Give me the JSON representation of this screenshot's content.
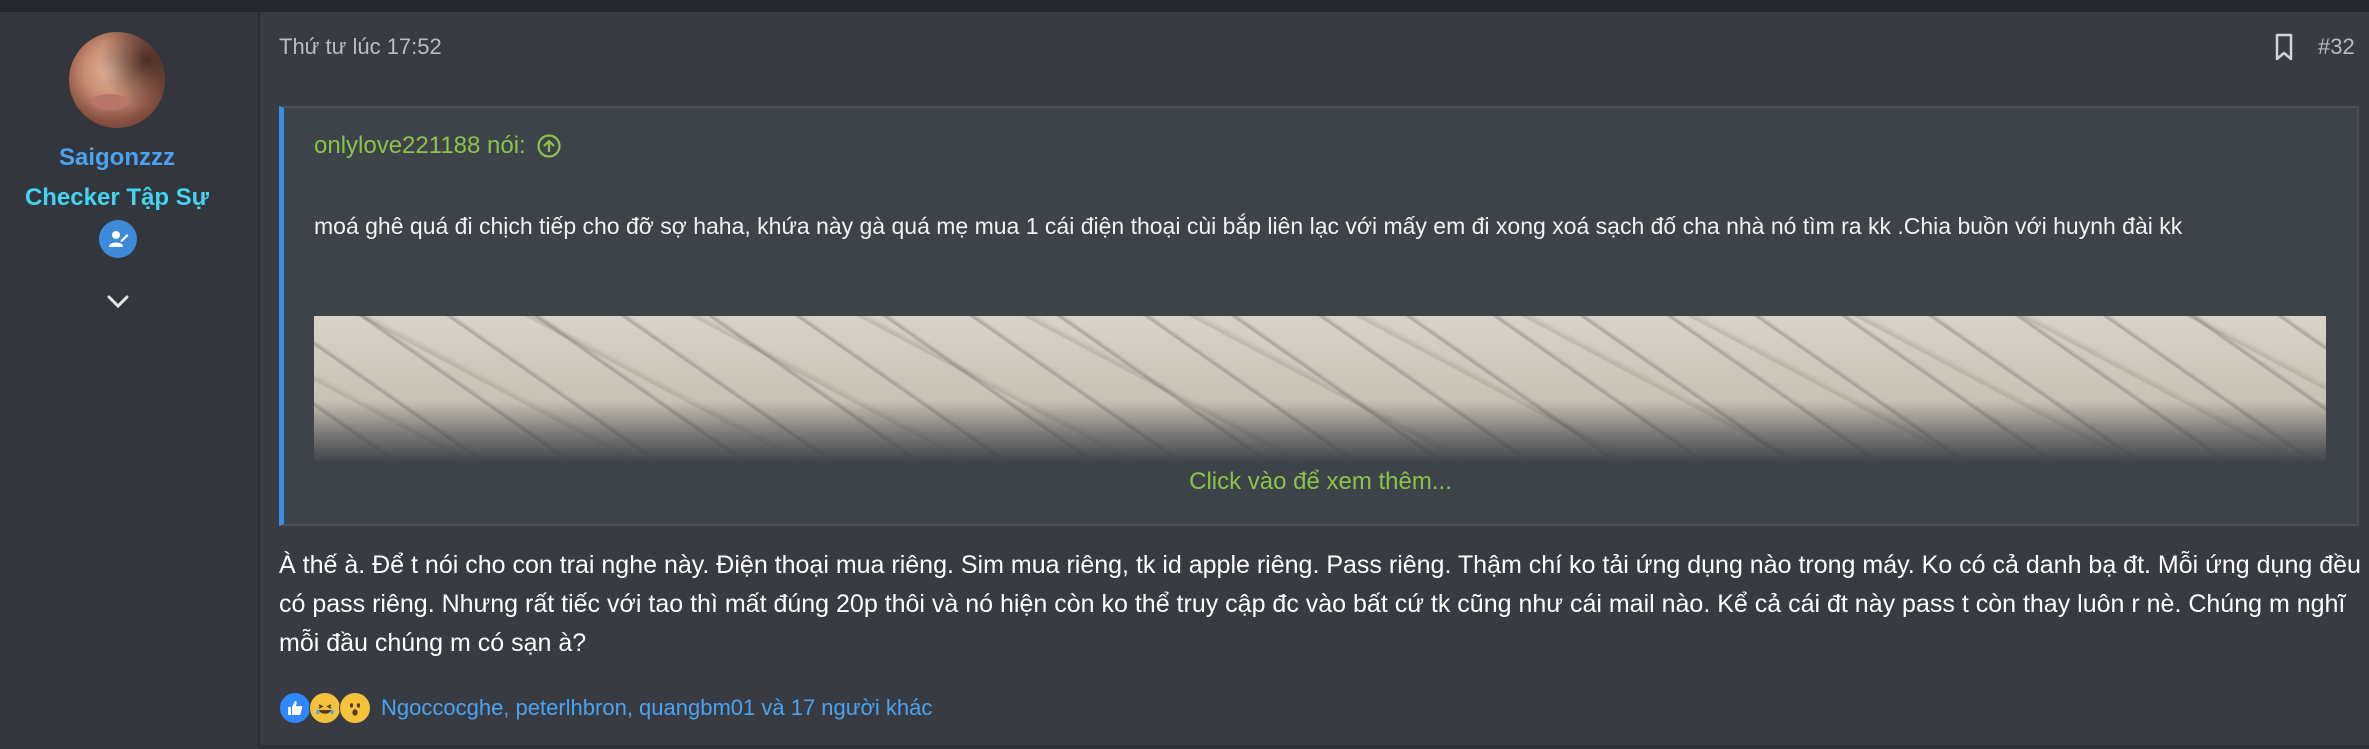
{
  "post": {
    "date": "Thứ tư lúc 17:52",
    "number": "#32",
    "author": {
      "username": "Saigonzzz",
      "title": "Checker Tập Sự"
    },
    "quote": {
      "author_label": "onlylove221188 nói:",
      "text": "moá ghê quá đi chịch tiếp cho đỡ sợ haha, khứa này gà quá mẹ mua 1 cái điện thoại cùi bắp liên lạc với mấy em đi xong xoá sạch đố cha nhà nó tìm ra kk .Chia buồn với huynh đài kk",
      "expand_label": "Click vào để xem thêm..."
    },
    "body": "À thế à. Để t nói cho con trai nghe này. Điện thoại mua riêng. Sim mua riêng, tk id apple riêng. Pass riêng. Thậm chí ko tải ứng dụng nào trong máy. Ko có cả danh bạ đt. Mỗi ứng dụng đều có pass riêng. Nhưng rất tiếc với tao thì mất đúng 20p thôi và nó hiện còn ko thể truy cập đc vào bất cứ tk cũng như cái mail nào. Kể cả cái đt này pass t còn thay luôn r nè. Chúng m nghĩ mỗi đầu chúng m có sạn à?",
    "reactions": {
      "icons": [
        "like-icon",
        "haha-icon",
        "wow-icon"
      ],
      "summary": "Ngoccocghe, peterlhbron, quangbm01 và 17 người khác"
    }
  },
  "colors": {
    "accent_blue": "#4aa3f0",
    "title_cyan": "#42d4f0",
    "quote_green": "#8bc34a",
    "quote_border": "#3b8ee8"
  }
}
